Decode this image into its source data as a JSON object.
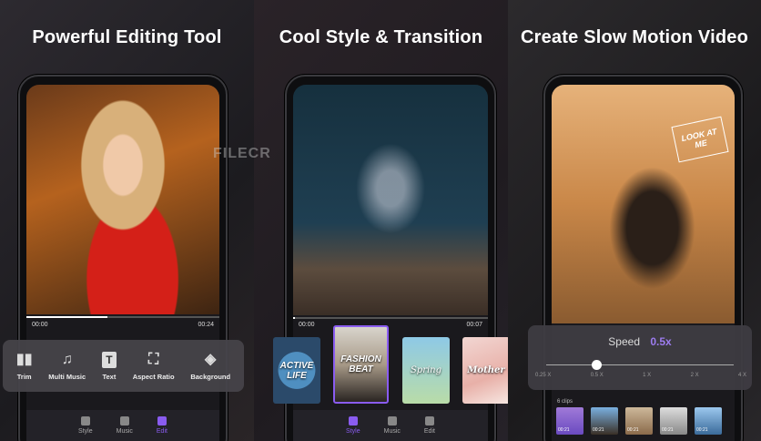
{
  "panels": [
    {
      "title": "Powerful Editing Tool",
      "time_start": "00:00",
      "time_end": "00:24",
      "progress": 0.42,
      "tools": [
        {
          "icon": "trim-icon",
          "glyph": "▮▮",
          "label": "Trim"
        },
        {
          "icon": "music-note-icon",
          "glyph": "♫",
          "label": "Multi Music"
        },
        {
          "icon": "text-icon",
          "glyph": "T",
          "label": "Text"
        },
        {
          "icon": "aspect-ratio-icon",
          "glyph": "⛶",
          "label": "Aspect Ratio"
        },
        {
          "icon": "paint-bucket-icon",
          "glyph": "◈",
          "label": "Background"
        }
      ],
      "nav": [
        "Style",
        "Music",
        "Edit"
      ],
      "nav_active": 2
    },
    {
      "title": "Cool Style & Transition",
      "time_start": "00:00",
      "time_end": "00:07",
      "progress": 0.01,
      "styles": [
        "ACTIVE LIFE",
        "FASHION BEAT",
        "Spring",
        "Mother"
      ],
      "selected_style": 1,
      "nav": [
        "Style",
        "Music",
        "Edit"
      ],
      "nav_active": 0
    },
    {
      "title": "Create Slow Motion Video",
      "sticker": "LOOK AT ME",
      "speed_label": "Speed",
      "speed_value": "0.5x",
      "speed_ticks": [
        "0.25 X",
        "0.5 X",
        "1 X",
        "2 X",
        "4 X"
      ],
      "clips_label": "6 clips",
      "clip_durations": [
        "00:21",
        "00:21",
        "00:21",
        "00:21",
        "00:21"
      ]
    }
  ],
  "watermark": "FILECR",
  "colors": {
    "accent": "#8a5cf0"
  }
}
